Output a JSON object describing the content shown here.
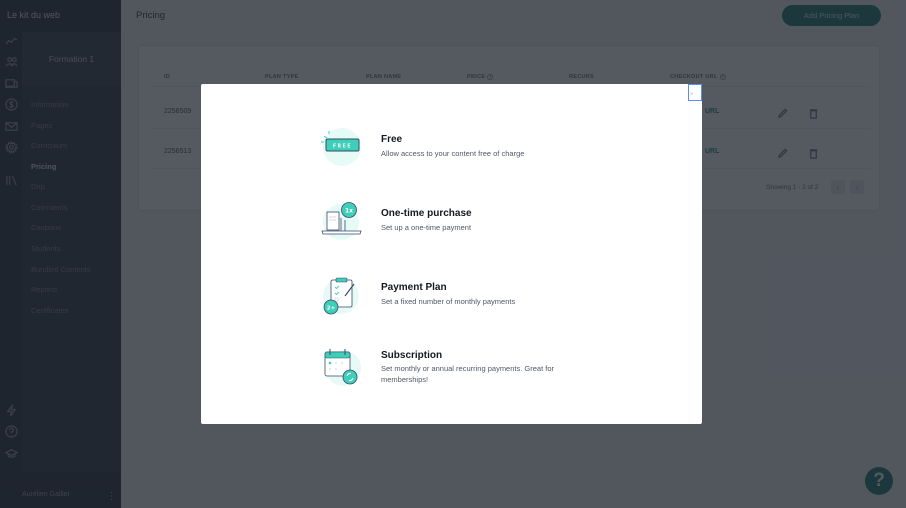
{
  "app": {
    "brand": "Le kit du web"
  },
  "sidebar": {
    "rail_icons": [
      "analytics-icon",
      "users-icon",
      "devices-icon",
      "dollar-icon",
      "mail-icon",
      "gear-icon",
      "library-icon"
    ],
    "bottom_icons": [
      "lightning-icon",
      "help-circle-icon",
      "graduation-cap-icon"
    ],
    "course_title": "Formation 1",
    "nav_items": [
      {
        "label": "Information",
        "active": false
      },
      {
        "label": "Pages",
        "active": false
      },
      {
        "label": "Curriculum",
        "active": false
      },
      {
        "label": "Pricing",
        "active": true
      },
      {
        "label": "Drip",
        "active": false
      },
      {
        "label": "Comments",
        "active": false
      },
      {
        "label": "Coupons",
        "active": false
      },
      {
        "label": "Students",
        "active": false
      },
      {
        "label": "Bundled Contents",
        "active": false
      },
      {
        "label": "Reports",
        "active": false
      },
      {
        "label": "Certificates",
        "active": false
      }
    ],
    "user_name": "Aurélien Gallier",
    "kebab": "⋮"
  },
  "main": {
    "page_title": "Pricing",
    "add_button_label": "Add Pricing Plan",
    "table": {
      "columns": [
        "ID",
        "PLAN TYPE",
        "PLAN NAME",
        "PRICE",
        "RECURS",
        "CHECKOUT URL"
      ],
      "rows": [
        {
          "id": "2256509",
          "checkout_url": "URL"
        },
        {
          "id": "2256513",
          "checkout_url": "URL"
        }
      ],
      "pagination": {
        "text": "Showing 1 - 2 of 2",
        "prev": "‹",
        "next": "›"
      }
    },
    "help_fab": "?"
  },
  "modal": {
    "close_label": "×",
    "options": [
      {
        "title": "Free",
        "description": "Allow access to your content free of charge",
        "icon": "free-tag-icon"
      },
      {
        "title": "One-time purchase",
        "description": "Set up a one-time payment",
        "icon": "one-time-payment-icon"
      },
      {
        "title": "Payment Plan",
        "description": "Set a fixed number of monthly payments",
        "icon": "payment-plan-clipboard-icon"
      },
      {
        "title": "Subscription",
        "description": "Set monthly or annual recurring payments. Great for memberships!",
        "icon": "subscription-calendar-icon"
      }
    ],
    "colors": {
      "accent": "#3ecfb9",
      "accent_light": "#e6faf6",
      "outline": "#3a4a6b"
    }
  }
}
